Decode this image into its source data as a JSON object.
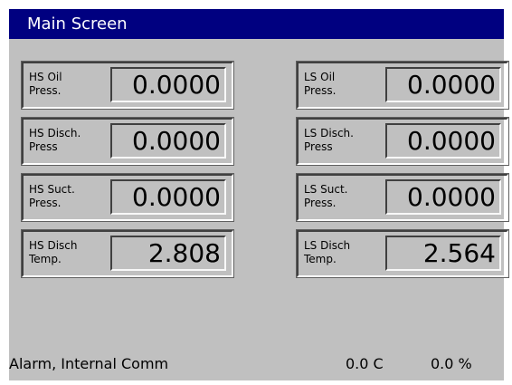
{
  "title": "Main Screen",
  "panels": [
    {
      "label_line1": "HS Oil",
      "label_line2": "Press.",
      "value": "0.0000"
    },
    {
      "label_line1": "LS Oil",
      "label_line2": "Press.",
      "value": "0.0000"
    },
    {
      "label_line1": "HS Disch.",
      "label_line2": "Press",
      "value": "0.0000"
    },
    {
      "label_line1": "LS Disch.",
      "label_line2": "Press",
      "value": "0.0000"
    },
    {
      "label_line1": "HS Suct.",
      "label_line2": "Press.",
      "value": "0.0000"
    },
    {
      "label_line1": "LS Suct.",
      "label_line2": "Press.",
      "value": "0.0000"
    },
    {
      "label_line1": "HS Disch",
      "label_line2": "Temp.",
      "value": "2.808"
    },
    {
      "label_line1": "LS Disch",
      "label_line2": "Temp.",
      "value": "2.564"
    }
  ],
  "status": {
    "alarm": "Alarm, Internal Comm",
    "temperature": "0.0 C",
    "percent": "0.0 %"
  }
}
